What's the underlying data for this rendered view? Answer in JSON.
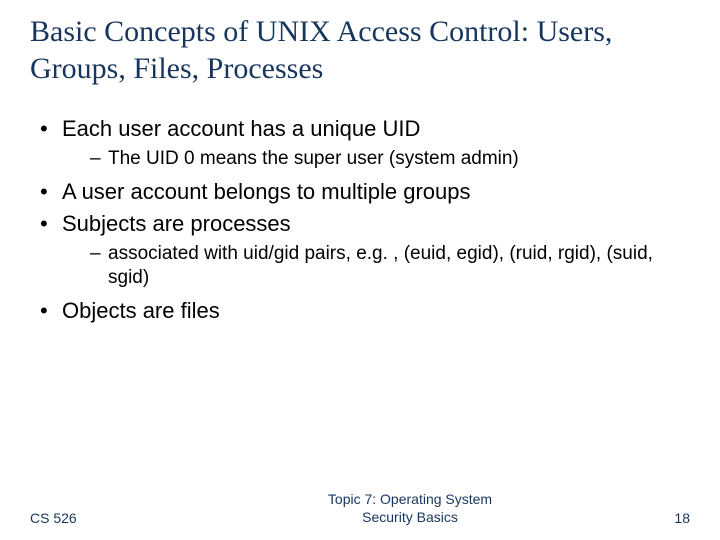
{
  "title": "Basic Concepts of UNIX Access Control: Users, Groups, Files, Processes",
  "bullets": [
    {
      "text": "Each user account has a unique UID",
      "sub": [
        "The UID 0 means the super user (system admin)"
      ]
    },
    {
      "text": "A user account belongs to multiple groups",
      "sub": []
    },
    {
      "text": "Subjects are processes",
      "sub": [
        "associated with uid/gid pairs, e.g. , (euid, egid), (ruid, rgid), (suid, sgid)"
      ]
    },
    {
      "text": "Objects are files",
      "sub": []
    }
  ],
  "footer": {
    "course": "CS 526",
    "topic_line1": "Topic 7: Operating System",
    "topic_line2": "Security Basics",
    "page": "18"
  }
}
